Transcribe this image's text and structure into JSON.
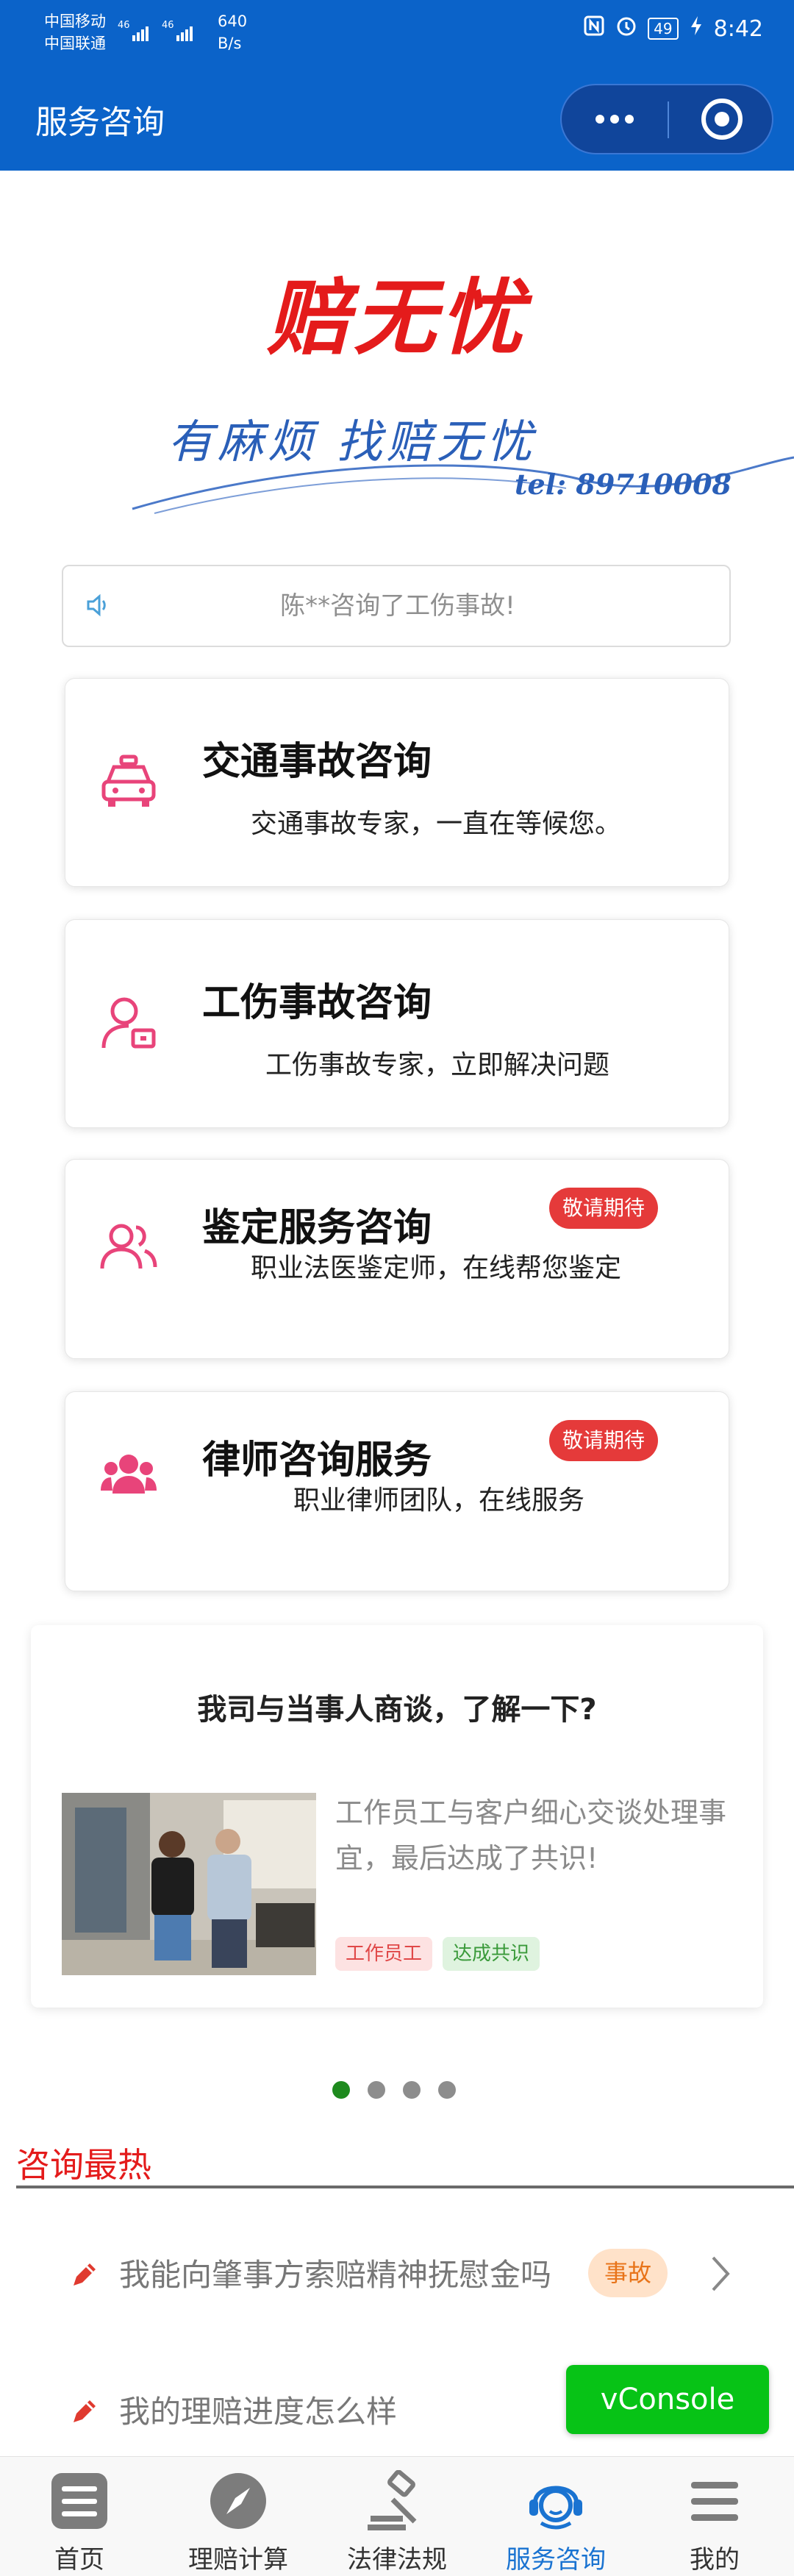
{
  "status_bar": {
    "carrier1": "中国移动",
    "carrier2": "中国联通",
    "net1": "46",
    "net2": "46",
    "speed_value": "640",
    "speed_unit": "B/s",
    "battery": "49",
    "time": "8:42"
  },
  "header": {
    "title": "服务咨询"
  },
  "logo": {
    "brand": "赔无忧",
    "slogan": "有麻烦  找赔无忧",
    "tel": "tel: 89710008"
  },
  "notice": {
    "text": "陈**咨询了工伤事故!"
  },
  "services": [
    {
      "title": "交通事故咨询",
      "subtitle": "交通事故专家，一直在等候您。",
      "icon": "taxi-icon"
    },
    {
      "title": "工伤事故咨询",
      "subtitle": "工伤事故专家，立即解决问题",
      "icon": "worker-icon"
    },
    {
      "title": "鉴定服务咨询",
      "subtitle": "职业法医鉴定师，在线帮您鉴定",
      "badge": "敬请期待",
      "icon": "users-icon"
    },
    {
      "title": "律师咨询服务",
      "subtitle": "职业律师团队，在线服务",
      "badge": "敬请期待",
      "icon": "team-icon"
    }
  ],
  "news": {
    "title": "我司与当事人商谈，了解一下?",
    "text": "工作员工与客户细心交谈处理事宜，最后达成了共识!",
    "tags": [
      "工作员工",
      "达成共识"
    ]
  },
  "carousel": {
    "total": 4,
    "active": 0
  },
  "hot": {
    "title": "咨询最热",
    "items": [
      {
        "question": "我能向肇事方索赔精神抚慰金吗",
        "tag": "事故"
      },
      {
        "question": "我的理赔进度怎么样"
      }
    ]
  },
  "vconsole": {
    "label": "vConsole"
  },
  "tabbar": [
    {
      "label": "首页",
      "icon": "home-icon"
    },
    {
      "label": "理赔计算",
      "icon": "compass-icon"
    },
    {
      "label": "法律法规",
      "icon": "gavel-icon"
    },
    {
      "label": "服务咨询",
      "icon": "service-icon",
      "active": true
    },
    {
      "label": "我的",
      "icon": "menu-icon"
    }
  ],
  "colors": {
    "primary": "#0b63c9",
    "brand_red": "#e41b1b",
    "icon_pink": "#e8447a",
    "badge_red": "#e53a3a",
    "vconsole_green": "#07c316",
    "active_tab": "#1a73d1"
  }
}
